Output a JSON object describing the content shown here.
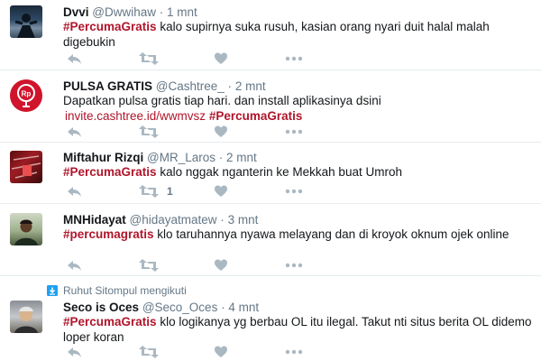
{
  "tweets": [
    {
      "name": "Dvvi",
      "handle": "@Dwwihaw",
      "sep": "·",
      "time": "1 mnt",
      "hashtag": "#PercumaGratis",
      "text": " kalo supirnya suka rusuh, kasian orang nyari duit halal malah digebukin"
    },
    {
      "name": "PULSA GRATIS",
      "handle": "@Cashtree_",
      "sep": "·",
      "time": "2 mnt",
      "text_line1": "Dapatkan pulsa gratis tiap hari. dan install aplikasinya dsini",
      "link": "invite.cashtree.id/wwmvsz",
      "hashtag": "#PercumaGratis",
      "avatar_label": "Rp"
    },
    {
      "name": "Miftahur Rizqi",
      "handle": "@MR_Laros",
      "sep": "·",
      "time": "2 mnt",
      "hashtag": "#PercumaGratis",
      "text": " kalo nggak nganterin ke Mekkah buat Umroh",
      "retweet_count": "1"
    },
    {
      "name": "MNHidayat",
      "handle": "@hidayatmatew",
      "sep": "·",
      "time": "3 mnt",
      "hashtag": "#percumagratis",
      "text": " klo taruhannya nyawa melayang dan di kroyok oknum ojek online"
    },
    {
      "context": "Ruhut Sitompul mengikuti",
      "name": "Seco is Oces",
      "handle": "@Seco_Oces",
      "sep": "·",
      "time": "4 mnt",
      "hashtag": "#PercumaGratis",
      "text": " klo logikanya yg berbau OL itu ilegal. Takut nti situs berita OL didemo loper koran"
    }
  ],
  "icons": {
    "reply": "reply-icon",
    "retweet": "retweet-icon",
    "like": "heart-icon",
    "more": "more-icon"
  },
  "colors": {
    "hashtag": "#b0152b",
    "muted": "#657786",
    "icon": "#aab8c2",
    "brand_red": "#d0142c"
  }
}
